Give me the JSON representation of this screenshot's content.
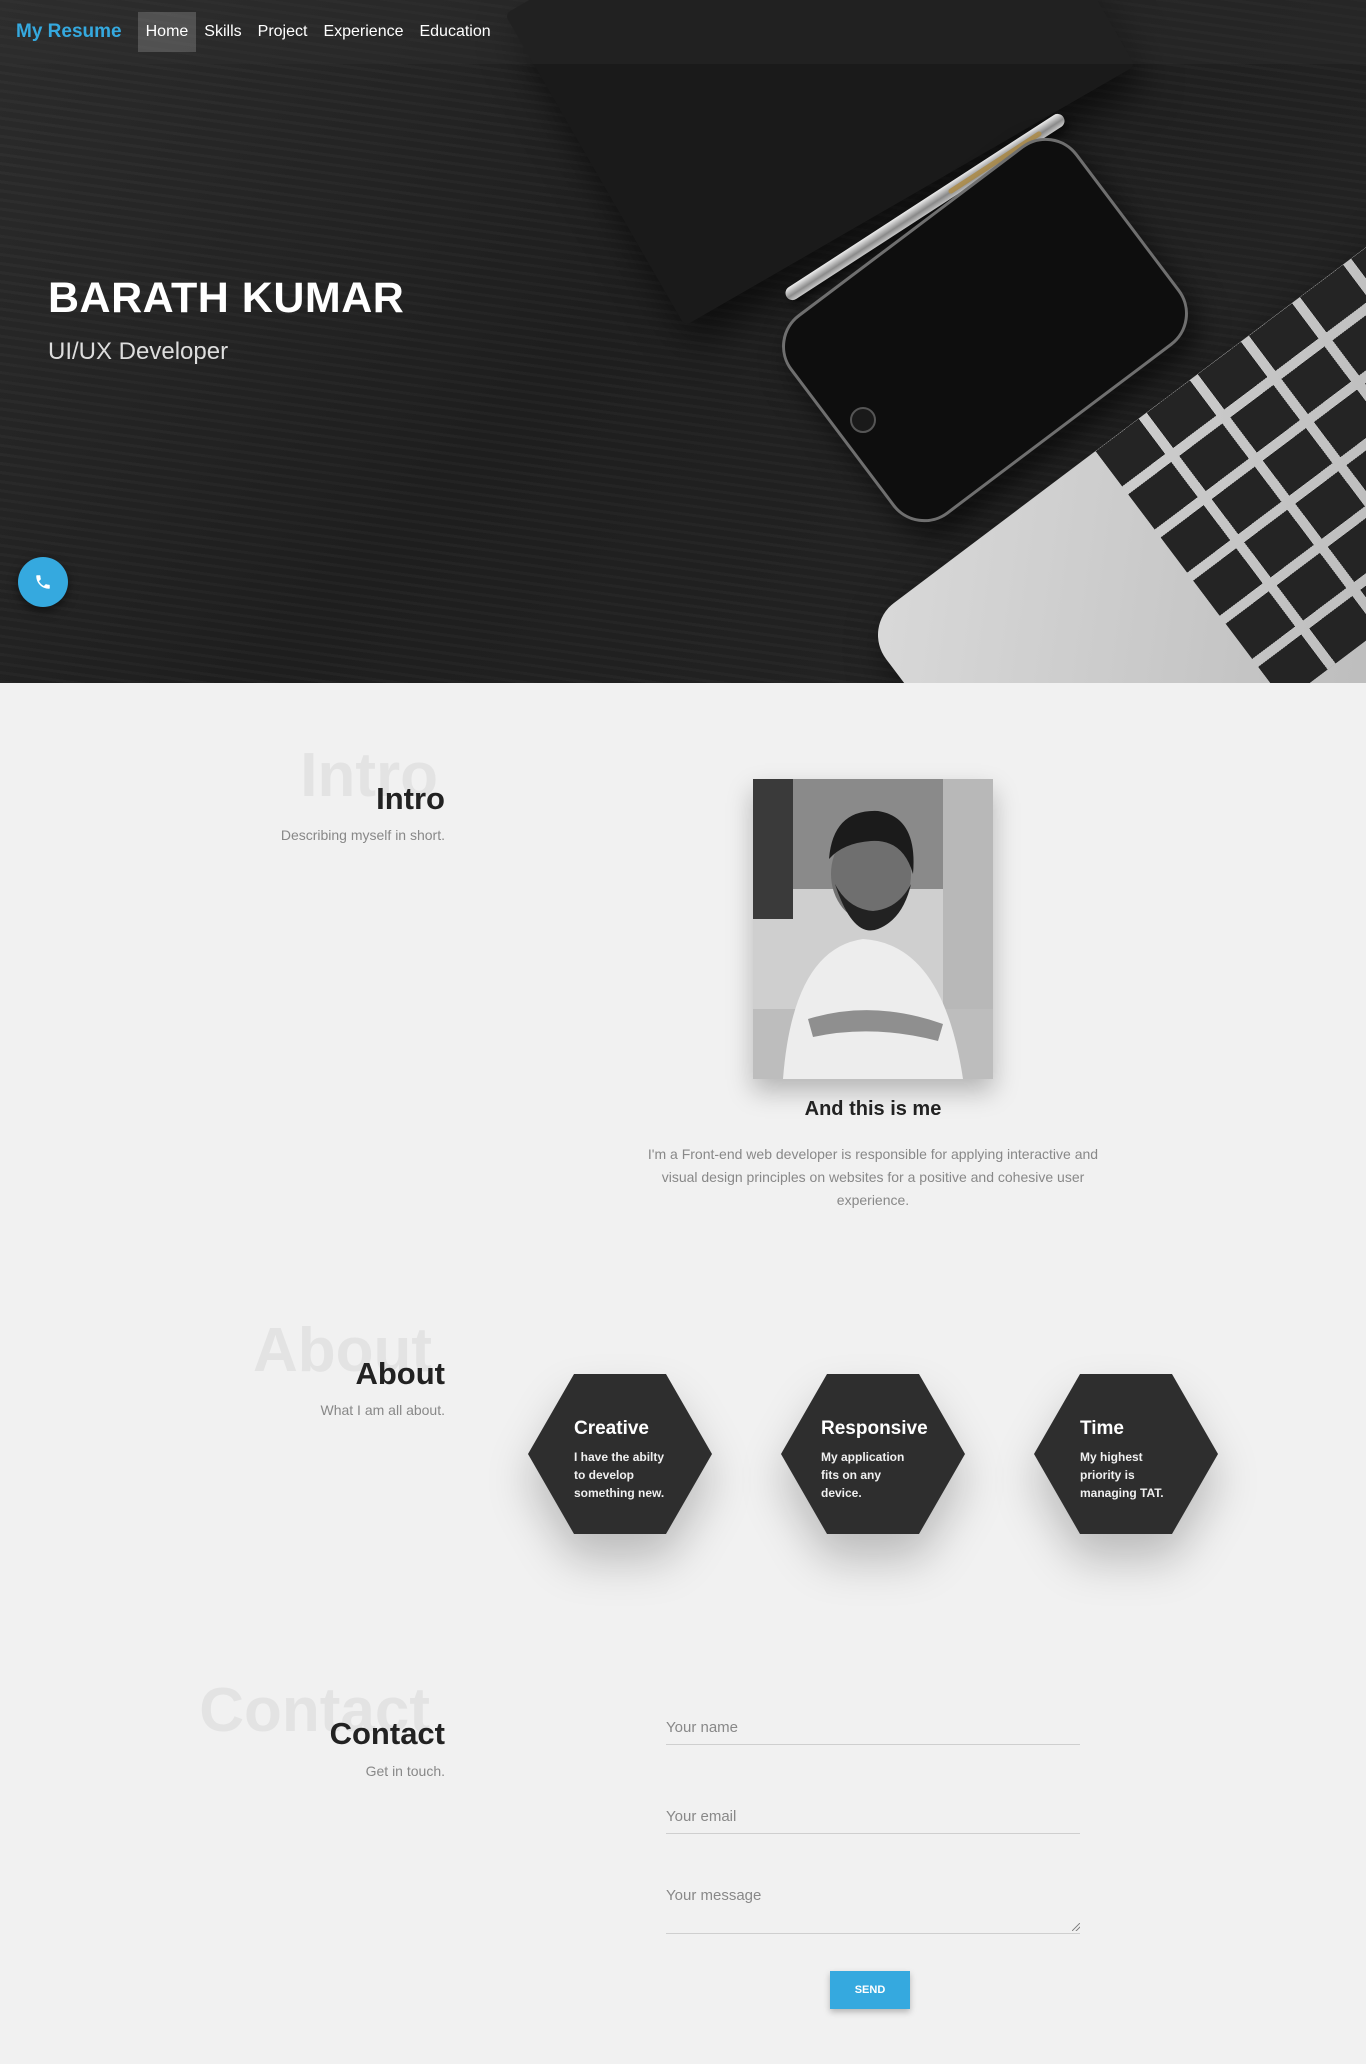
{
  "nav": {
    "brand": "My Resume",
    "items": [
      {
        "label": "Home",
        "active": true
      },
      {
        "label": "Skills",
        "active": false
      },
      {
        "label": "Project",
        "active": false
      },
      {
        "label": "Experience",
        "active": false
      },
      {
        "label": "Education",
        "active": false
      }
    ]
  },
  "hero": {
    "name": "BARATH KUMAR",
    "role": "UI/UX Developer"
  },
  "intro": {
    "bg_title": "Intro",
    "title": "Intro",
    "subtitle": "Describing myself in short.",
    "photo_caption": "And this is me",
    "description": "I'm a Front-end web developer is responsible for applying interactive and visual design principles on websites for a positive and cohesive user experience."
  },
  "about": {
    "bg_title": "About",
    "title": "About",
    "subtitle": "What I am all about.",
    "cards": [
      {
        "title": "Creative",
        "text": "I have the abilty to develop something new."
      },
      {
        "title": "Responsive",
        "text": "My application fits on any device."
      },
      {
        "title": "Time",
        "text": "My highest priority is managing TAT."
      }
    ]
  },
  "contact": {
    "bg_title": "Contact",
    "title": "Contact",
    "subtitle": "Get in touch.",
    "name_placeholder": "Your name",
    "email_placeholder": "Your email",
    "message_placeholder": "Your message",
    "send_label": "SEND"
  },
  "colors": {
    "accent": "#35a9df",
    "hex_bg": "#2e2e2e",
    "page_bg": "#f1f1f1"
  },
  "icons": {
    "fab": "phone-icon"
  }
}
